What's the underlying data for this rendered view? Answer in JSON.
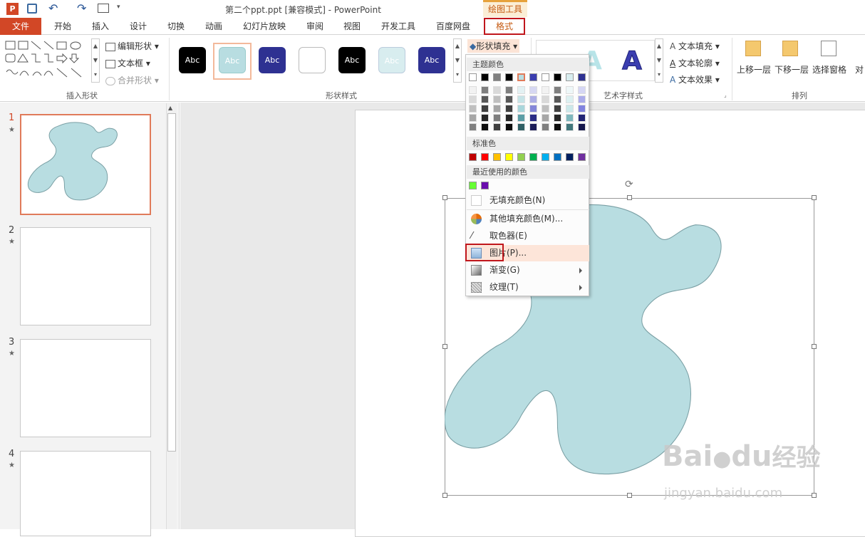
{
  "title": "第二个ppt.ppt [兼容模式] - PowerPoint",
  "contextual_tab_group": "绘图工具",
  "tabs": [
    "开始",
    "插入",
    "设计",
    "切换",
    "动画",
    "幻灯片放映",
    "审阅",
    "视图",
    "开发工具",
    "百度网盘"
  ],
  "file_tab": "文件",
  "format_tab": "格式",
  "ribbon": {
    "insert_shapes": {
      "label": "插入形状",
      "edit_shape": "编辑形状",
      "text_box": "文本框",
      "merge_shapes": "合并形状"
    },
    "shape_styles": {
      "label": "形状样式",
      "sample": "Abc",
      "shape_fill": "形状填充"
    },
    "wordart": {
      "label": "艺术字样式",
      "text_fill": "文本填充",
      "text_outline": "文本轮廓",
      "text_effects": "文本效果",
      "letter": "A"
    },
    "arrange": {
      "label": "排列",
      "bring_forward": "上移一层",
      "send_backward": "下移一层",
      "selection_pane": "选择窗格",
      "align": "对"
    }
  },
  "dropdown": {
    "theme_colors": "主题颜色",
    "standard_colors": "标准色",
    "recent_colors": "最近使用的颜色",
    "no_fill": "无填充颜色(N)",
    "more_fill": "其他填充颜色(M)...",
    "eyedropper": "取色器(E)",
    "picture": "图片(P)...",
    "gradient": "渐变(G)",
    "texture": "纹理(T)",
    "standard_swatches": [
      "#c00000",
      "#ff0000",
      "#ffc000",
      "#ffff00",
      "#92d050",
      "#00b050",
      "#00b0f0",
      "#0070c0",
      "#002060",
      "#7030a0"
    ],
    "recent_swatches": [
      "#66ff33",
      "#6a0dad"
    ]
  },
  "slides": [
    "1",
    "2",
    "3",
    "4"
  ],
  "shape_fill_color": "#b8dde1",
  "watermark": {
    "brand": "Bai",
    "brand2": "du",
    "jingyan": "经验",
    "url": "jingyan.baidu.com"
  }
}
